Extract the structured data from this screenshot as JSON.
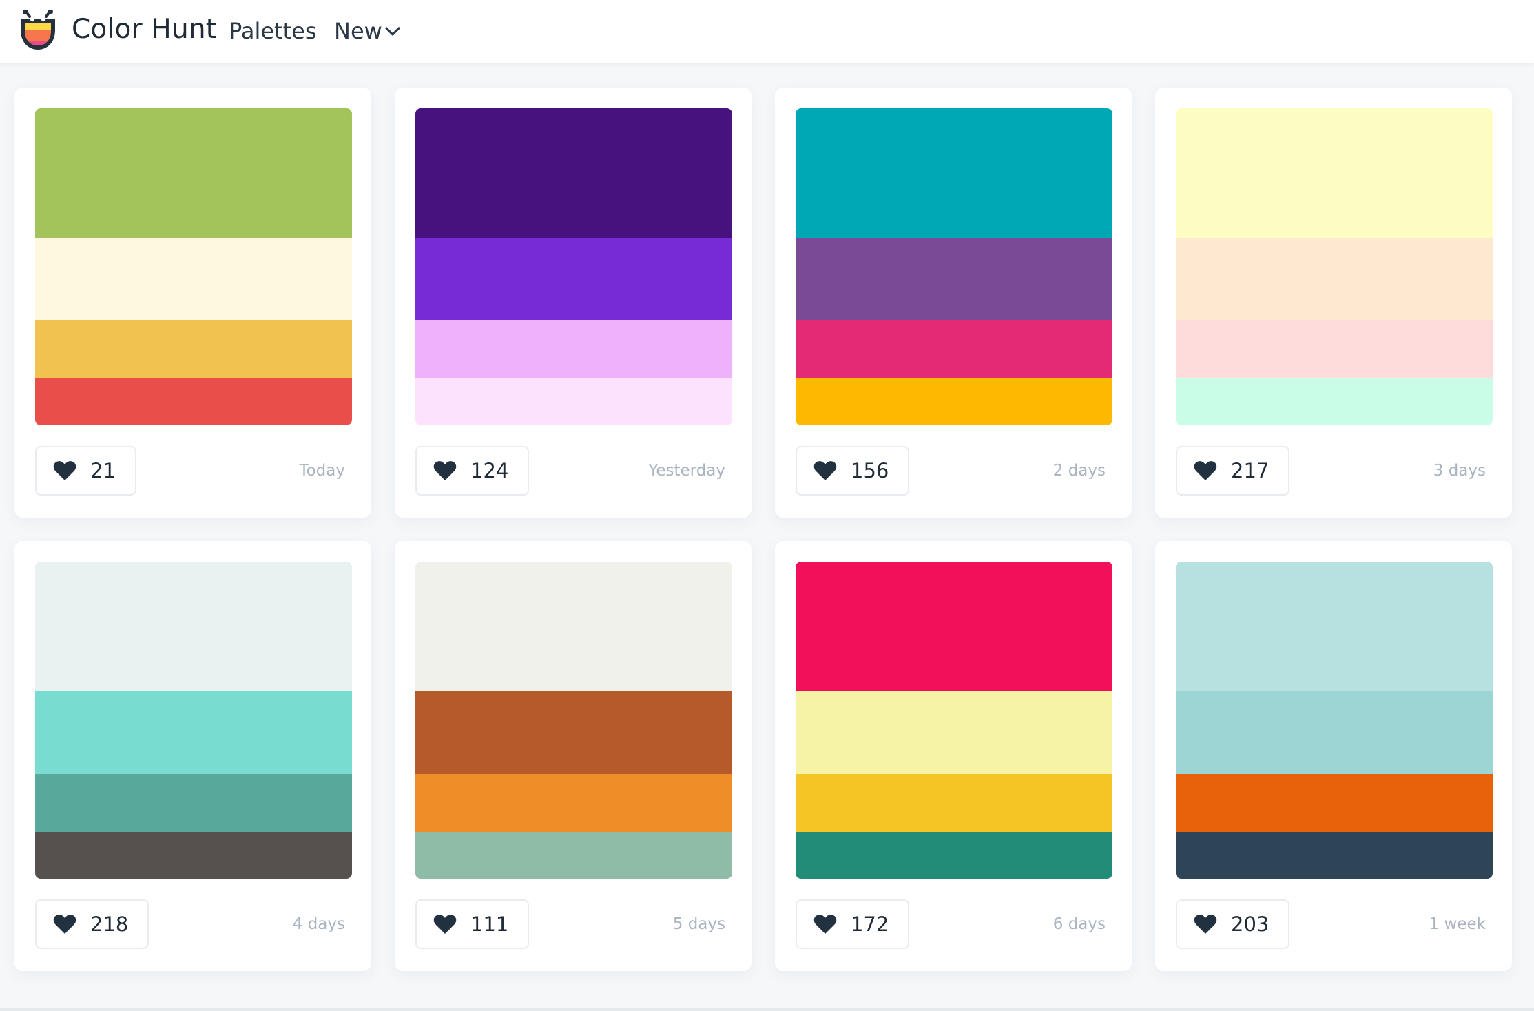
{
  "header": {
    "brand": "Color Hunt",
    "nav_palettes": "Palettes",
    "nav_new": "New"
  },
  "palettes": [
    {
      "colors": [
        "#a3c45a",
        "#fff8e1",
        "#f1c24f",
        "#ea4e4b"
      ],
      "likes": "21",
      "date": "Today"
    },
    {
      "colors": [
        "#48127e",
        "#762bd6",
        "#efb1fc",
        "#fde2fe"
      ],
      "likes": "124",
      "date": "Yesterday"
    },
    {
      "colors": [
        "#00a7b5",
        "#7b4a97",
        "#e42a74",
        "#fcb900"
      ],
      "likes": "156",
      "date": "2 days"
    },
    {
      "colors": [
        "#fdfdc3",
        "#fee8d0",
        "#fedcdb",
        "#cafde8"
      ],
      "likes": "217",
      "date": "3 days"
    },
    {
      "colors": [
        "#eaf1f1",
        "#78dcd1",
        "#58a99b",
        "#56504e"
      ],
      "likes": "218",
      "date": "4 days"
    },
    {
      "colors": [
        "#f1f1ec",
        "#b55b2b",
        "#ef8e29",
        "#8fbca7"
      ],
      "likes": "111",
      "date": "5 days"
    },
    {
      "colors": [
        "#f2105b",
        "#f6f3a6",
        "#f4c524",
        "#228c79"
      ],
      "likes": "172",
      "date": "6 days"
    },
    {
      "colors": [
        "#b7e1e0",
        "#9dd5d5",
        "#e8620c",
        "#2e4457"
      ],
      "likes": "203",
      "date": "1 week"
    }
  ]
}
